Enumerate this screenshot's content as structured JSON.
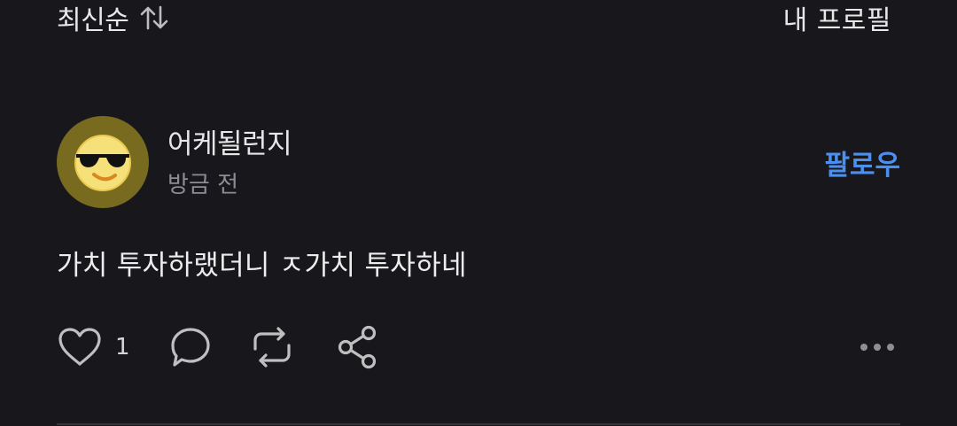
{
  "sort": {
    "label": "최신순",
    "icon": "sort-arrows-icon"
  },
  "profile_link": {
    "label": "내 프로필"
  },
  "post": {
    "author": "어케될런지",
    "time": "방금 전",
    "follow_label": "팔로우",
    "text": "가치 투자하랬더니 ㅈ가치 투자하네",
    "likes": "1",
    "avatar_icon": "sunglasses-emoji-icon"
  },
  "colors": {
    "background": "#18171c",
    "accent": "#4b8fef",
    "avatar_bg": "#786a1f",
    "secondary_text": "#8d8d93"
  },
  "icons": {
    "like": "heart-icon",
    "comment": "comment-bubble-icon",
    "repost": "repost-icon",
    "share": "share-icon",
    "more": "more-dots-icon"
  }
}
